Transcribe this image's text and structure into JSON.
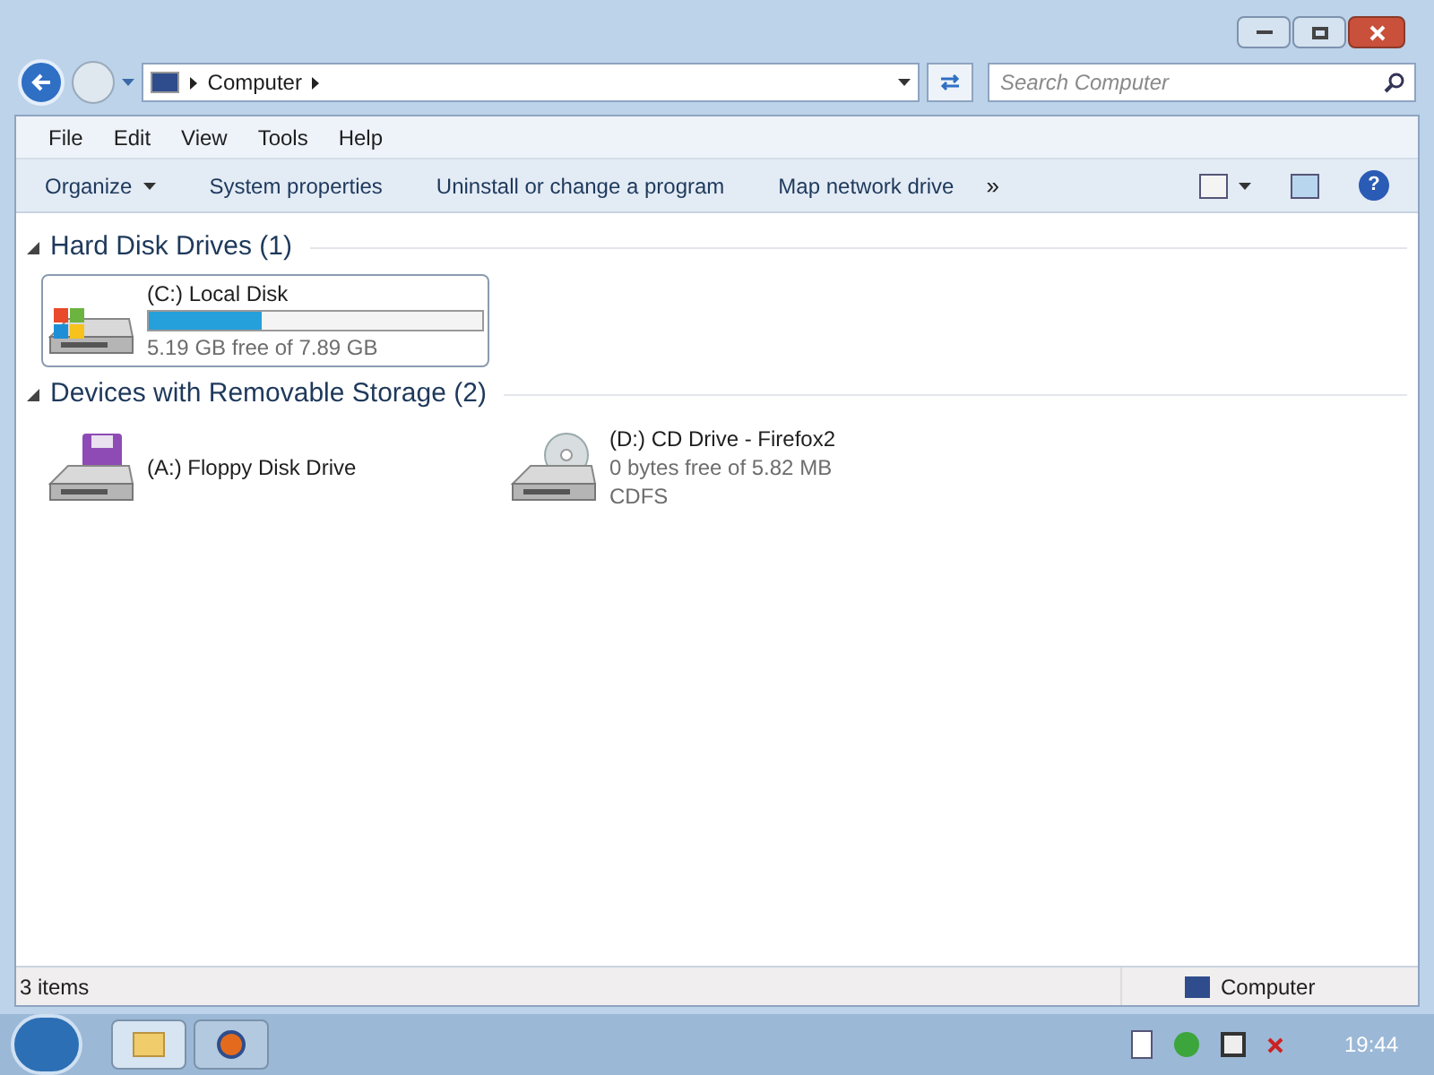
{
  "address": {
    "crumbs": [
      "Computer"
    ]
  },
  "search": {
    "placeholder": "Search Computer"
  },
  "menu": [
    "File",
    "Edit",
    "View",
    "Tools",
    "Help"
  ],
  "toolbar": [
    {
      "label": "Organize",
      "dropdown": true
    },
    {
      "label": "System properties",
      "dropdown": false
    },
    {
      "label": "Uninstall or change a program",
      "dropdown": false
    },
    {
      "label": "Map network drive",
      "dropdown": false
    }
  ],
  "overflow": "»",
  "groups": [
    {
      "title": "Hard Disk Drives (1)",
      "expanded": true,
      "items": [
        {
          "kind": "hdd",
          "name": "(C:) Local Disk",
          "level": 0.34,
          "detail": "5.19 GB free of 7.89 GB",
          "selected": true
        }
      ]
    },
    {
      "title": "Devices with Removable Storage (2)",
      "expanded": true,
      "items": [
        {
          "kind": "floppy",
          "name": "(A:) Floppy Disk Drive",
          "selected": false
        },
        {
          "kind": "cd",
          "name": "(D:) CD Drive - Firefox2",
          "detail": "0 bytes free of 5.82 MB",
          "fs": "CDFS",
          "selected": false
        }
      ]
    }
  ],
  "status": {
    "count": "3 items",
    "location": "Computer"
  },
  "clock": "19:44",
  "help": "?"
}
